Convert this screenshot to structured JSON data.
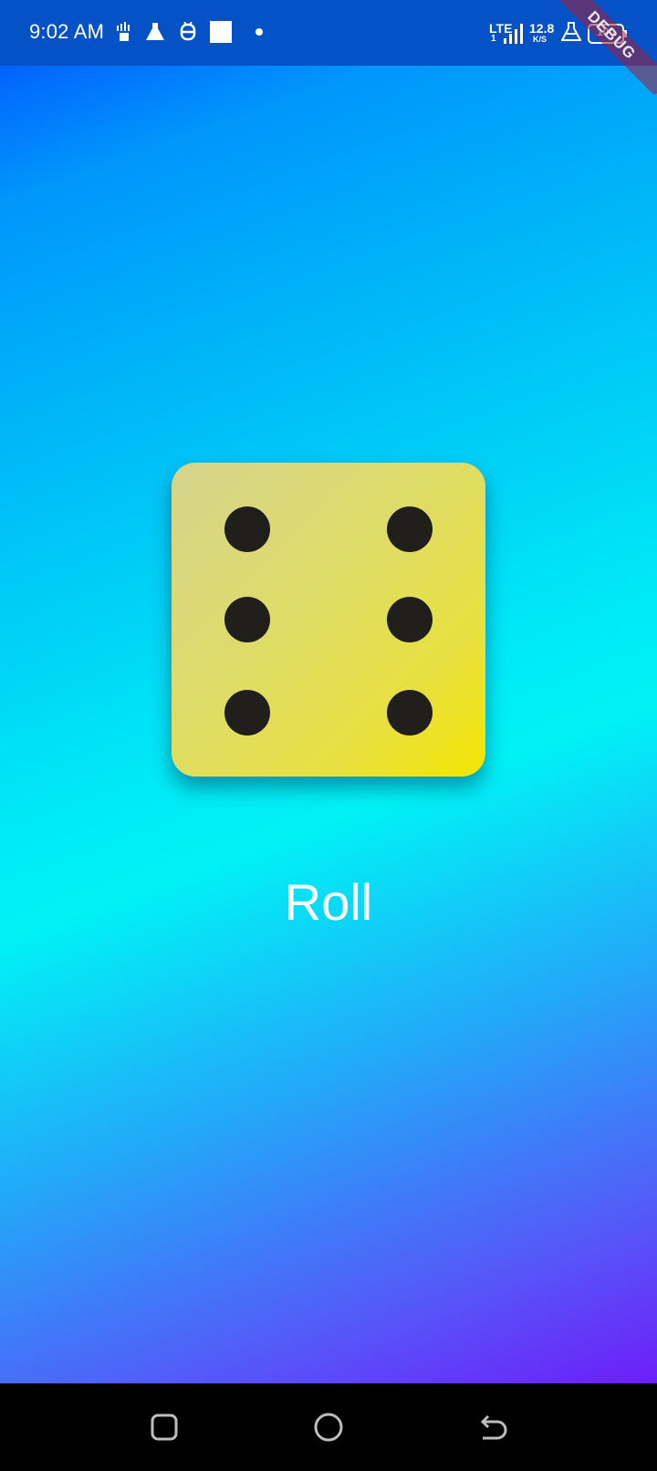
{
  "status_bar": {
    "time": "9:02 AM",
    "network_type": "LTE",
    "network_sub": "1",
    "speed_value": "12.8",
    "speed_unit": "K/S",
    "battery": "100",
    "left_icons": [
      "sim-card-icon",
      "flask-icon",
      "android-debug-icon",
      "square-notification-icon",
      "dot-icon"
    ],
    "right_icons": [
      "signal-icon",
      "flask-icon",
      "battery-icon"
    ]
  },
  "debug_banner": "DEBUG",
  "dice": {
    "face_value": 6,
    "pip_color": "#201f1b",
    "face_colors": [
      "#d6d48e",
      "#f3e500"
    ]
  },
  "roll_button": {
    "label": "Roll"
  },
  "nav_bar": {
    "buttons": [
      "recent-apps-icon",
      "home-icon",
      "back-icon"
    ]
  },
  "colors": {
    "status_bar": "#0452c6",
    "gradient_top": "#0349ff",
    "gradient_mid": "#00f2f6",
    "gradient_bottom": "#7a00f8"
  }
}
